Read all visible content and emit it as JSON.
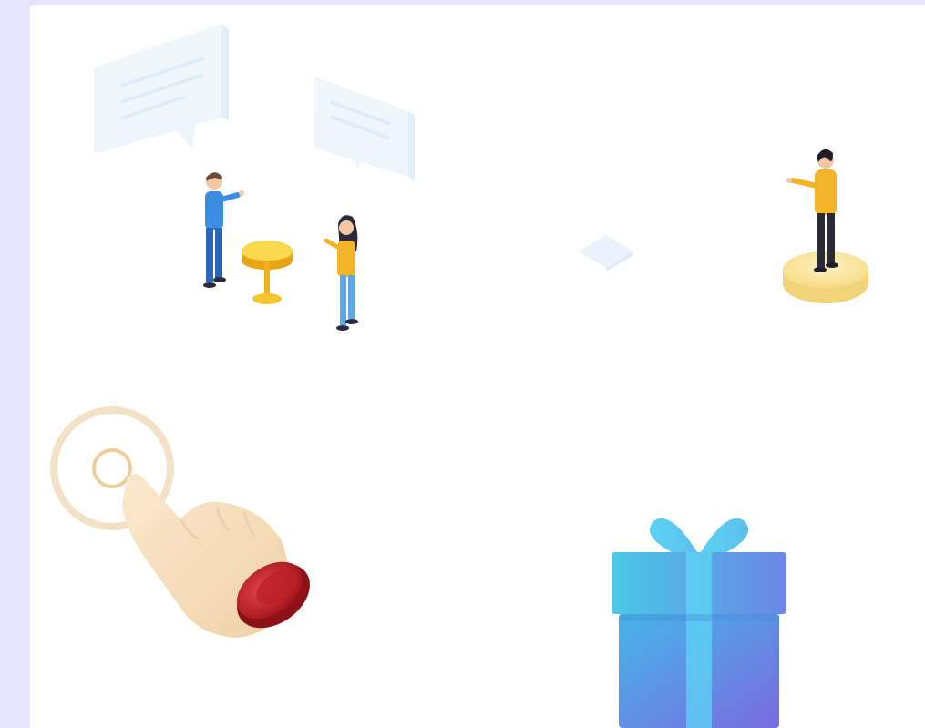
{
  "colors": {
    "background": "#e6e4fa",
    "panel": "#ffffff",
    "accent_yellow": "#f2c12e",
    "accent_blue": "#3f8fd9",
    "bubble": "#eef5fb",
    "gift_top": "#5fd0ee",
    "gift_bottom": "#6f7fe6",
    "button_red": "#c9282e"
  },
  "illustrations": [
    {
      "icon": "conversation-people-icon"
    },
    {
      "icon": "presenter-on-podium-icon"
    },
    {
      "icon": "diamond-tile-icon"
    },
    {
      "icon": "finger-press-button-icon"
    },
    {
      "icon": "gift-box-icon"
    }
  ]
}
